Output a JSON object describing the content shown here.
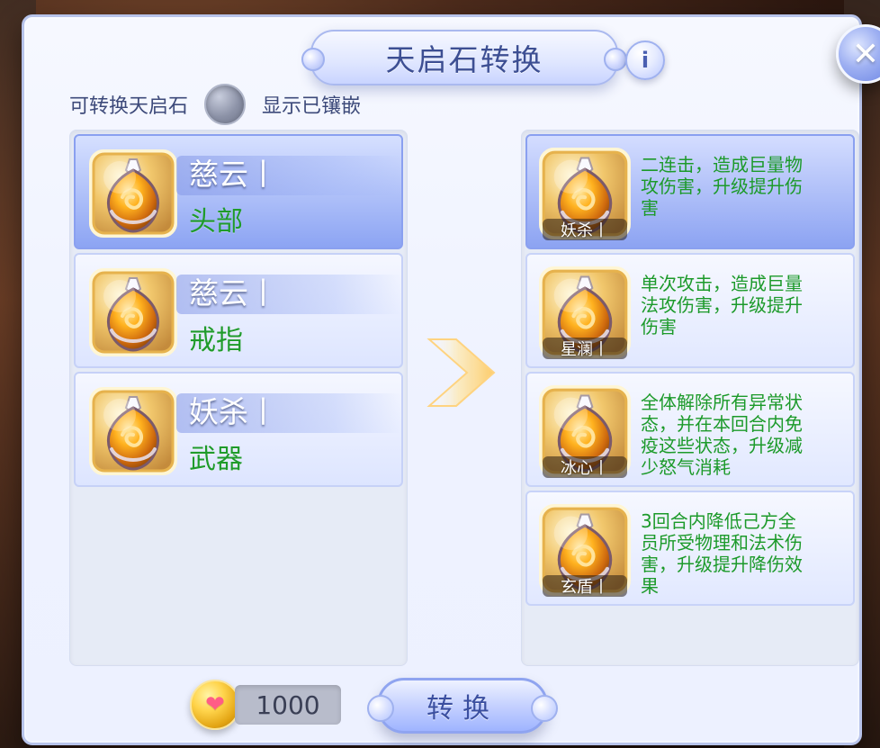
{
  "dialog": {
    "title": "天启石转换",
    "filter": {
      "label_left": "可转换天启石",
      "label_right": "显示已镶嵌"
    }
  },
  "left_list": {
    "items": [
      {
        "name": "慈云丨",
        "slot": "头部",
        "selected": true
      },
      {
        "name": "慈云丨",
        "slot": "戒指",
        "selected": false
      },
      {
        "name": "妖杀丨",
        "slot": "武器",
        "selected": false
      }
    ]
  },
  "right_list": {
    "items": [
      {
        "label": "妖杀丨",
        "description": "二连击，造成巨量物\n攻伤害，升级提升伤\n害",
        "selected": true
      },
      {
        "label": "星澜丨",
        "description": "单次攻击，造成巨量\n法攻伤害，升级提升\n伤害",
        "selected": false
      },
      {
        "label": "冰心丨",
        "description": "全体解除所有异常状\n态，并在本回合内免\n疫这些状态，升级减\n少怒气消耗",
        "selected": false
      },
      {
        "label": "玄盾丨",
        "description": "3回合内降低己方全\n员所受物理和法术伤\n害，升级提升降伤效\n果",
        "selected": false
      }
    ]
  },
  "footer": {
    "currency_amount": "1000",
    "convert_label": "转换"
  },
  "icons": {
    "info": "info-icon",
    "close": "close-icon",
    "coin": "heart-coin-icon",
    "arrow": "arrow-right-icon",
    "stone": "sky-stone-icon"
  },
  "colors": {
    "green_text": "#1c9a2a",
    "accent_blue": "#8aa0f0",
    "title_blue": "#3d4f93"
  }
}
